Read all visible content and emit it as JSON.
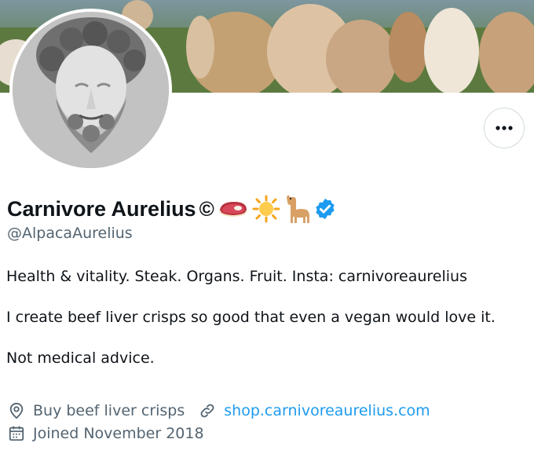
{
  "profile": {
    "display_name": "Carnivore Aurelius",
    "copyright_symbol": "©",
    "emojis": [
      "steak-emoji",
      "sun-emoji",
      "llama-emoji"
    ],
    "verified": true,
    "handle": "@AlpacaAurelius",
    "bio_lines": [
      "Health & vitality. Steak. Organs. Fruit. Insta: carnivoreaurelius",
      "I create beef liver crisps so good that even a vegan would love it.",
      "Not medical advice."
    ],
    "location": "Buy beef liver crisps",
    "website": "shop.carnivoreaurelius.com",
    "joined": "Joined November 2018"
  },
  "icons": {
    "more": "more-options-icon",
    "location": "location-pin-icon",
    "link": "link-icon",
    "calendar": "calendar-icon",
    "verified": "verified-badge-icon"
  },
  "colors": {
    "text_primary": "#0f1419",
    "text_secondary": "#536471",
    "link": "#1d9bf0",
    "verified": "#1d9bf0",
    "border": "#cfd9de"
  }
}
